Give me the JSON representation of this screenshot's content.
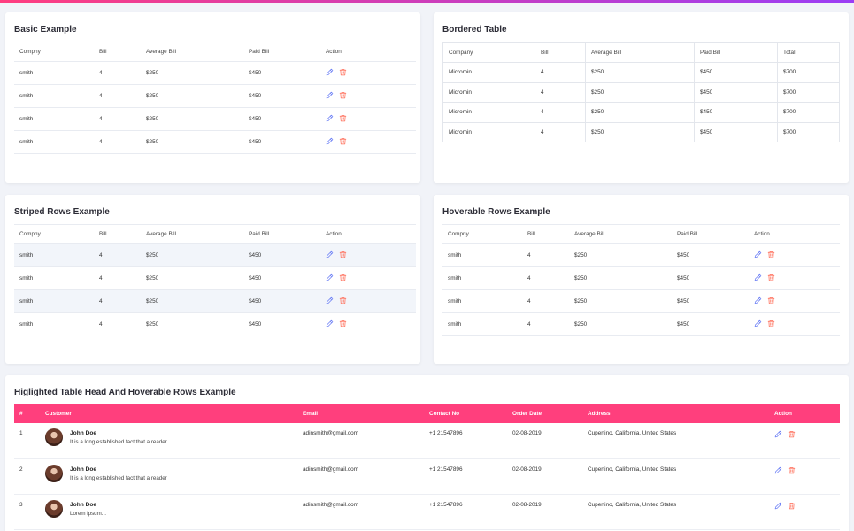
{
  "basic": {
    "title": "Basic Example",
    "headers": [
      "Compny",
      "Bill",
      "Average Bill",
      "Paid Bill",
      "Action"
    ],
    "rows": [
      [
        "smith",
        "4",
        "$250",
        "$450"
      ],
      [
        "smith",
        "4",
        "$250",
        "$450"
      ],
      [
        "smith",
        "4",
        "$250",
        "$450"
      ],
      [
        "smith",
        "4",
        "$250",
        "$450"
      ]
    ]
  },
  "bordered": {
    "title": "Bordered Table",
    "headers": [
      "Company",
      "Bill",
      "Average Bill",
      "Paid Bill",
      "Total"
    ],
    "rows": [
      [
        "Micromin",
        "4",
        "$250",
        "$450",
        "$700"
      ],
      [
        "Micromin",
        "4",
        "$250",
        "$450",
        "$700"
      ],
      [
        "Micromin",
        "4",
        "$250",
        "$450",
        "$700"
      ],
      [
        "Micromin",
        "4",
        "$250",
        "$450",
        "$700"
      ]
    ]
  },
  "striped": {
    "title": "Striped Rows Example",
    "headers": [
      "Compny",
      "Bill",
      "Average Bill",
      "Paid Bill",
      "Action"
    ],
    "rows": [
      [
        "smith",
        "4",
        "$250",
        "$450"
      ],
      [
        "smith",
        "4",
        "$250",
        "$450"
      ],
      [
        "smith",
        "4",
        "$250",
        "$450"
      ],
      [
        "smith",
        "4",
        "$250",
        "$450"
      ]
    ]
  },
  "hoverable": {
    "title": "Hoverable Rows Example",
    "headers": [
      "Compny",
      "Bill",
      "Average Bill",
      "Paid Bill",
      "Action"
    ],
    "rows": [
      [
        "smith",
        "4",
        "$250",
        "$450"
      ],
      [
        "smith",
        "4",
        "$250",
        "$450"
      ],
      [
        "smith",
        "4",
        "$250",
        "$450"
      ],
      [
        "smith",
        "4",
        "$250",
        "$450"
      ]
    ]
  },
  "highlighted": {
    "title": "Higlighted Table Head And Hoverable Rows Example",
    "headers": [
      "#",
      "Customer",
      "Email",
      "Contact No",
      "Order Date",
      "Address",
      "Action"
    ],
    "rows": [
      {
        "num": "1",
        "name": "John Doe",
        "desc": "It is a long established fact that a reader",
        "email": "adinsmith@gmail.com",
        "contact": "+1 21547896",
        "date": "02-08-2019",
        "address": "Cupertino, California, United States"
      },
      {
        "num": "2",
        "name": "John Doe",
        "desc": "It is a long established fact that a reader",
        "email": "adinsmith@gmail.com",
        "contact": "+1 21547896",
        "date": "02-08-2019",
        "address": "Cupertino, California, United States"
      },
      {
        "num": "3",
        "name": "John Doe",
        "desc": "Lorem ipsum...",
        "email": "adinsmith@gmail.com",
        "contact": "+1 21547896",
        "date": "02-08-2019",
        "address": "Cupertino, California, United States"
      }
    ]
  },
  "colors": {
    "accent": "#ff3f7d",
    "edit": "#6a7ef5",
    "delete": "#ff6a55"
  },
  "icons": {
    "edit": "pencil-icon",
    "delete": "trash-icon"
  }
}
